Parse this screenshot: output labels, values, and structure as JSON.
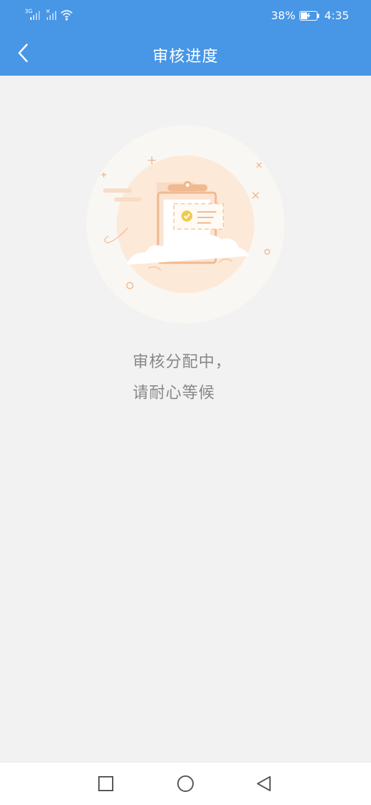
{
  "status_bar": {
    "network_label": "3G",
    "battery_percent": "38%",
    "time": "4:35",
    "icons": [
      "signal-3g-icon",
      "signal-icon",
      "wifi-icon",
      "battery-charging-icon"
    ]
  },
  "header": {
    "title": "审核进度",
    "back_icon": "chevron-left-icon",
    "background_color": "#4896e6"
  },
  "main": {
    "illustration": "clipboard-review-illustration",
    "message_line1": "审核分配中，",
    "message_line2": "请耐心等候"
  },
  "bottom_nav": {
    "icons": [
      "recents-square-icon",
      "home-circle-icon",
      "back-triangle-icon"
    ]
  },
  "colors": {
    "accent": "#4896e6",
    "page_background": "#f2f2f2",
    "message_text": "#888888",
    "illustration_orange": "#f0b98f",
    "illustration_gold": "#f2c94c"
  }
}
